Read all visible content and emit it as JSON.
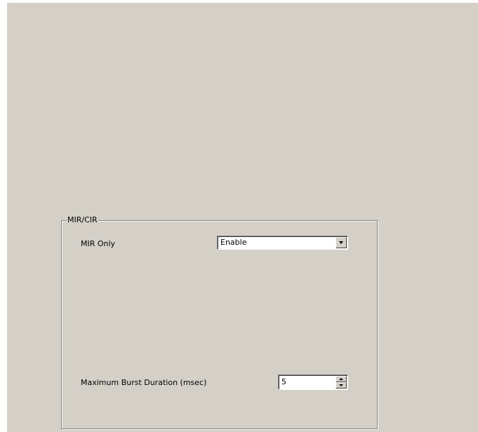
{
  "mir_cir": {
    "group_title": "MIR/CIR",
    "mir_only": {
      "label": "MIR Only",
      "selected": "Enable"
    },
    "max_burst": {
      "label": "Maximum Burst Duration (msec)",
      "value": "5"
    }
  },
  "icons": {
    "combo_dropdown": "chevron-down-icon",
    "spin_up": "arrow-up-icon",
    "spin_down": "arrow-down-icon"
  },
  "colors": {
    "panel_background": "#d4d0c8",
    "page_background": "#ffffff"
  }
}
